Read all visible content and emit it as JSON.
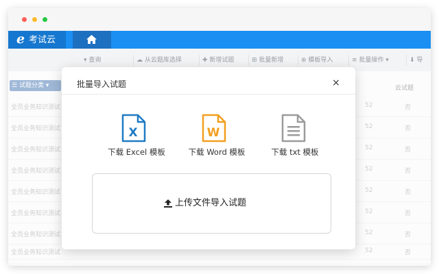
{
  "app": {
    "logo_glyph": "e",
    "name": "考试云"
  },
  "toolbar": {
    "buttons": [
      {
        "label": "▾ 查询"
      },
      {
        "label": "☁ 从云题库选择"
      },
      {
        "label": "✚ 新增试题"
      },
      {
        "label": "⊞ 批量新增"
      },
      {
        "label": "⊕ 模板导入"
      },
      {
        "label": "≡ 批量操作 ▾"
      },
      {
        "label": "⬇ 导"
      }
    ]
  },
  "table": {
    "category_button": "☰ 试题分类 ▾",
    "header_right": "云试题",
    "rows": [
      {
        "name": "全员业务知识测试",
        "code": "52",
        "cloud": "否"
      },
      {
        "name": "全员业务知识测试",
        "code": "52",
        "cloud": "否"
      },
      {
        "name": "全员业务知识测试",
        "code": "52",
        "cloud": "否"
      },
      {
        "name": "全员业务知识测试",
        "code": "52",
        "cloud": "否"
      },
      {
        "name": "全员业务知识测试",
        "code": "52",
        "cloud": "否"
      },
      {
        "name": "全员业务知识测试",
        "code": "52",
        "cloud": "否"
      },
      {
        "name": "全员业务知识测试",
        "code": "52",
        "cloud": "否"
      },
      {
        "name": "全员业务知识测试",
        "code": "52",
        "cloud": "否"
      }
    ]
  },
  "modal": {
    "title": "批量导入试题",
    "close": "×",
    "templates": [
      {
        "letter": "X",
        "label": "下载 Excel 模板"
      },
      {
        "letter": "W",
        "label": "下载 Word 模板"
      },
      {
        "letter": "",
        "label": "下载 txt 模板"
      }
    ],
    "upload_label": "上传文件导入试题"
  },
  "colors": {
    "primary": "#1b8ff2",
    "brand_dark": "#1577cf",
    "excel": "#1f7bc4",
    "word": "#f29f1f",
    "txt": "#9b9b9b"
  }
}
